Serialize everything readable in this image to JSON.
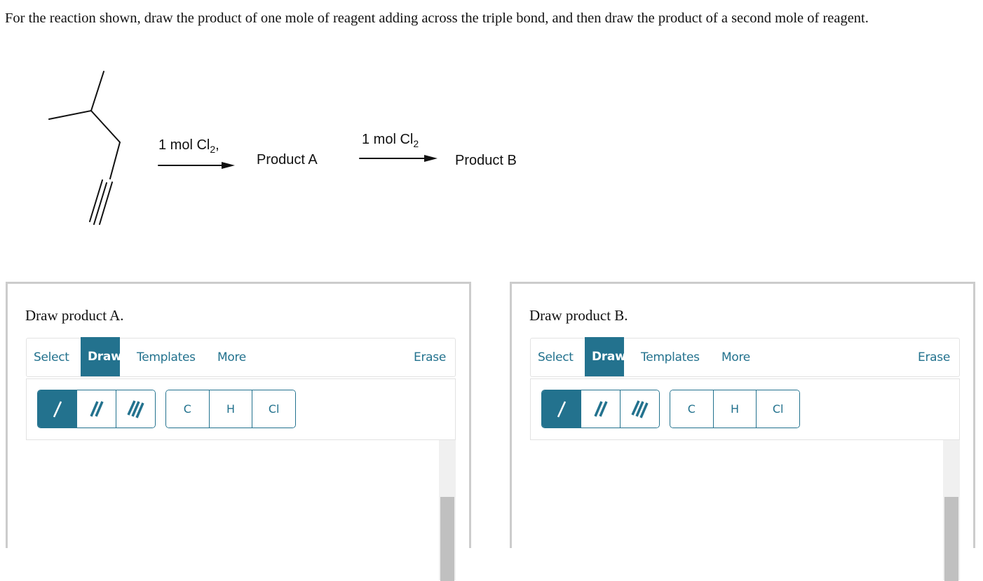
{
  "prompt": "For the reaction shown, draw the product of one mole of reagent adding across the triple bond, and then draw the product of a second mole of reagent.",
  "scheme": {
    "starting_material": "4-methyl-1-pentyne (skeletal structure)",
    "arrow1_reagent": "1 mol Cl",
    "arrow1_subscript": "2",
    "arrow1_suffix": ",",
    "intermediate_label": "Product A",
    "arrow2_reagent": "1 mol Cl",
    "arrow2_subscript": "2",
    "product_label": "Product B"
  },
  "panels": [
    {
      "title": "Draw product A.",
      "tabs": {
        "select": "Select",
        "draw": "Draw",
        "templates": "Templates",
        "more": "More",
        "erase": "Erase"
      },
      "active_tab": "Draw",
      "bond_tools": [
        "single-bond",
        "double-bond",
        "triple-bond"
      ],
      "active_bond": "single-bond",
      "atoms": [
        "C",
        "H",
        "Cl"
      ]
    },
    {
      "title": "Draw product B.",
      "tabs": {
        "select": "Select",
        "draw": "Draw",
        "templates": "Templates",
        "more": "More",
        "erase": "Erase"
      },
      "active_tab": "Draw",
      "bond_tools": [
        "single-bond",
        "double-bond",
        "triple-bond"
      ],
      "active_bond": "single-bond",
      "atoms": [
        "C",
        "H",
        "Cl"
      ]
    }
  ],
  "colors": {
    "accent": "#23728e",
    "panel_border": "#cccccc",
    "scroll_thumb": "#c0c0c0"
  }
}
